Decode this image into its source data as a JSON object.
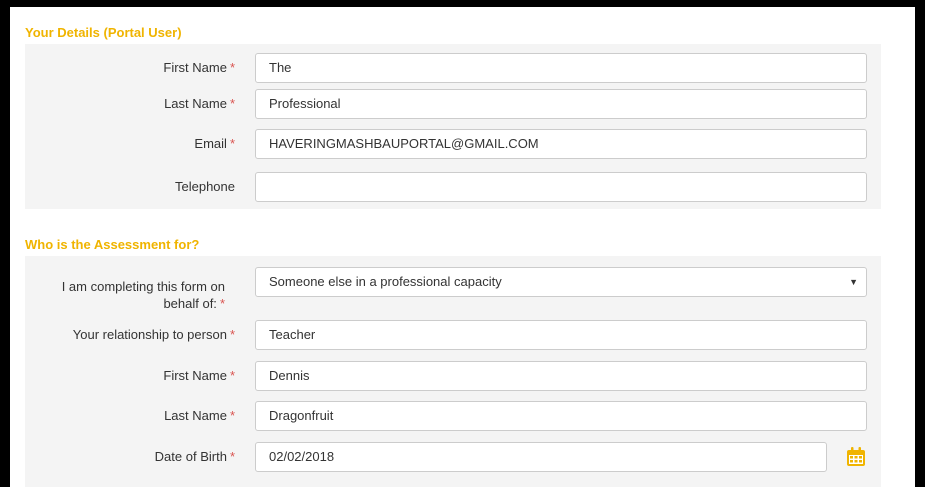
{
  "sections": {
    "details_title": "Your Details (Portal User)",
    "assessment_title": "Who is the Assessment for?"
  },
  "details": {
    "first_name": {
      "label": "First Name",
      "value": "The"
    },
    "last_name": {
      "label": "Last Name",
      "value": "Professional"
    },
    "email": {
      "label": "Email",
      "value": "HAVERINGMASHBAUPORTAL@GMAIL.COM"
    },
    "telephone": {
      "label": "Telephone",
      "value": ""
    }
  },
  "assessment": {
    "behalf": {
      "label_line1": "I am completing this form on",
      "label_line2": "behalf of:",
      "value": "Someone else in a professional capacity"
    },
    "relationship": {
      "label": "Your relationship to person",
      "value": "Teacher"
    },
    "first_name": {
      "label": "First Name",
      "value": "Dennis"
    },
    "last_name": {
      "label": "Last Name",
      "value": "Dragonfruit"
    },
    "dob": {
      "label": "Date of Birth",
      "value": "02/02/2018"
    }
  },
  "required_marker": "*",
  "colors": {
    "accent": "#f0b400",
    "required": "#d9534f",
    "panel": "#f4f4f4"
  },
  "icons": {
    "calendar": "calendar-icon",
    "caret": "caret-down-icon"
  }
}
